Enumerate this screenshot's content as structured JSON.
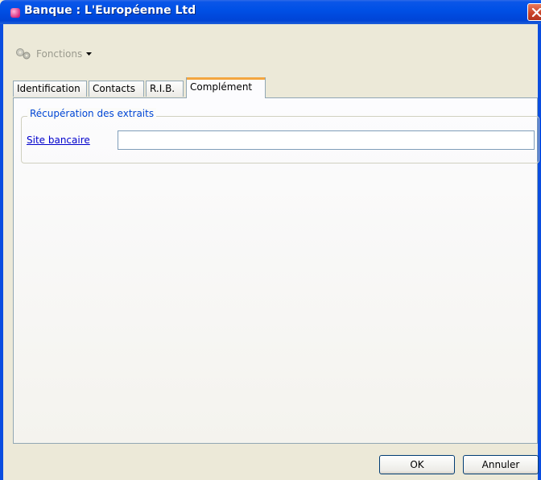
{
  "window": {
    "title": "Banque : L'Européenne Ltd",
    "accent": "#0050e6"
  },
  "toolbar": {
    "functions_label": "Fonctions"
  },
  "tabs": [
    {
      "label": "Identification",
      "active": false
    },
    {
      "label": "Contacts",
      "active": false
    },
    {
      "label": "R.I.B.",
      "active": false
    },
    {
      "label": "Complément",
      "active": true
    }
  ],
  "extracts_group": {
    "legend": "Récupération des extraits",
    "site_label": "Site bancaire",
    "site_value": ""
  },
  "buttons": {
    "ok": "OK",
    "cancel": "Annuler"
  }
}
